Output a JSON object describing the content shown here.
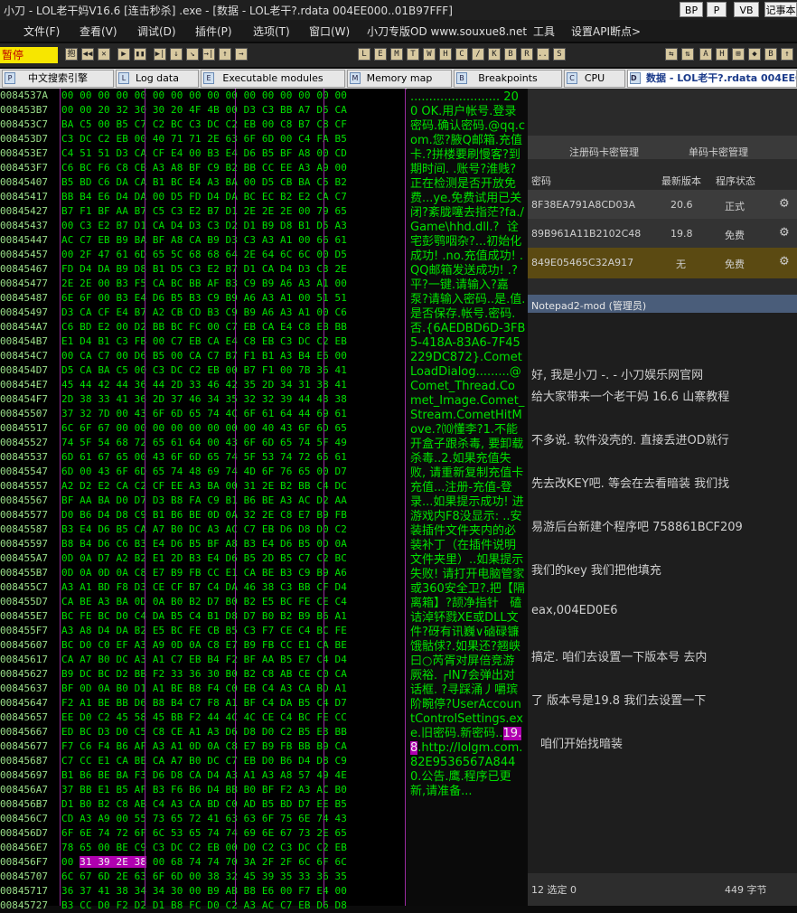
{
  "window": {
    "title": "小刀   - LOL老干妈V16.6 [连击秒杀] .exe - [数据 - LOL老干?.rdata 004EE000..01B97FFF]",
    "buttons": [
      "BP",
      "P",
      "VB",
      "记事本"
    ]
  },
  "menu": [
    "文件(F)",
    "查看(V)",
    "调试(D)",
    "插件(P)",
    "选项(T)",
    "窗口(W)",
    "小刀专版OD www.souxue8.net",
    "工具",
    "设置API断点>"
  ],
  "toolbar": {
    "status": "暂停",
    "left_icons": [
      "抱",
      "◀◀",
      "✕",
      "▶",
      "▮▮",
      "▶|",
      "↓",
      "↘",
      "→|",
      "↑",
      "→"
    ],
    "letter_icons": [
      "L",
      "E",
      "M",
      "T",
      "W",
      "H",
      "C",
      "/",
      "K",
      "B",
      "R",
      "...",
      "S"
    ],
    "right_icons": [
      "⇆",
      "⇅",
      "A",
      "H",
      "⊞",
      "◆",
      "B",
      "↑",
      "▦",
      "✕",
      "A",
      "▣"
    ]
  },
  "tabs": [
    {
      "label": "中文搜索引擎",
      "icon": "P"
    },
    {
      "label": "Log data",
      "icon": "L"
    },
    {
      "label": "Executable modules",
      "icon": "E"
    },
    {
      "label": "Memory map",
      "icon": "M"
    },
    {
      "label": "Breakpoints",
      "icon": "B"
    },
    {
      "label": "CPU",
      "icon": "C"
    },
    {
      "label": "数据 - LOL老干?.rdata 004EE0",
      "icon": "D"
    }
  ],
  "dump": [
    {
      "addr": "0084537A",
      "hex": "00 00 00 00 00 00 00 00 00 00 00 00 00 00 00 00"
    },
    {
      "addr": "008453B7",
      "hex": "00 00 20 32 30 30 20 4F 4B 00 D3 C3 BB A7 D5 CA"
    },
    {
      "addr": "008453C7",
      "hex": "BA C5 00 B5 C7 C2 BC C3 DC C2 EB 00 C8 B7 C8 CF"
    },
    {
      "addr": "008453D7",
      "hex": "C3 DC C2 EB 00 40 71 71 2E 63 6F 6D 00 C4 FA B5"
    },
    {
      "addr": "008453E7",
      "hex": "C4 51 51 D3 CA CF E4 00 B3 E4 D6 B5 BF A8 00 CD"
    },
    {
      "addr": "008453F7",
      "hex": "C6 BC F6 C8 CB A3 A8 BF C9 B2 BB CC EE A3 A9 00"
    },
    {
      "addr": "00845407",
      "hex": "B5 BD C6 DA CA B1 BC E4 A3 BA 00 D5 CB BA C5 B2"
    },
    {
      "addr": "00845417",
      "hex": "BB B4 E6 D4 DA 00 D5 FD D4 DA BC EC B2 E2 CA C7"
    },
    {
      "addr": "00845427",
      "hex": "B7 F1 BF AA B7 C5 C3 E2 B7 D1 2E 2E 2E 00 79 65"
    },
    {
      "addr": "00845437",
      "hex": "00 C3 E2 B7 D1 CA D4 D3 C3 D2 D1 B9 D8 B1 D5 A3"
    },
    {
      "addr": "00845447",
      "hex": "AC C7 EB B9 BA BF A8 CA B9 D3 C3 A3 A1 00 66 61"
    },
    {
      "addr": "00845457",
      "hex": "00 2F 47 61 6D 65 5C 68 68 64 2E 64 6C 6C 00 D5"
    },
    {
      "addr": "00845467",
      "hex": "FD D4 DA B9 D8 B1 D5 C3 E2 B7 D1 CA D4 D3 C3 2E"
    },
    {
      "addr": "00845477",
      "hex": "2E 2E 00 B3 F5 CA BC BB AF B3 C9 B9 A6 A3 A1 00"
    },
    {
      "addr": "00845487",
      "hex": "6E 6F 00 B3 E4 D6 B5 B3 C9 B9 A6 A3 A1 00 51 51"
    },
    {
      "addr": "00845497",
      "hex": "D3 CA CF E4 B7 A2 CB CD B3 C9 B9 A6 A3 A1 00 C6"
    },
    {
      "addr": "008454A7",
      "hex": "C6 BD E2 00 D2 BB BC FC 00 C7 EB CA E4 C8 EB BB"
    },
    {
      "addr": "008454B7",
      "hex": "E1 D4 B1 C3 FB 00 C7 EB CA E4 C8 EB C3 DC C2 EB"
    },
    {
      "addr": "008454C7",
      "hex": "00 CA C7 00 D6 B5 00 CA C7 B7 F1 B1 A3 B4 E6 00"
    },
    {
      "addr": "008454D7",
      "hex": "D5 CA BA C5 00 C3 DC C2 EB 00 B7 F1 00 7B 36 41"
    },
    {
      "addr": "008454E7",
      "hex": "45 44 42 44 36 44 2D 33 46 42 35 2D 34 31 38 41"
    },
    {
      "addr": "008454F7",
      "hex": "2D 38 33 41 36 2D 37 46 34 35 32 32 39 44 43 38"
    },
    {
      "addr": "00845507",
      "hex": "37 32 7D 00 43 6F 6D 65 74 4C 6F 61 64 44 69 61"
    },
    {
      "addr": "00845517",
      "hex": "6C 6F 67 00 00 00 00 00 00 00 00 40 43 6F 6D 65"
    },
    {
      "addr": "00845527",
      "hex": "74 5F 54 68 72 65 61 64 00 43 6F 6D 65 74 5F 49"
    },
    {
      "addr": "00845537",
      "hex": "6D 61 67 65 00 43 6F 6D 65 74 5F 53 74 72 65 61"
    },
    {
      "addr": "00845547",
      "hex": "6D 00 43 6F 6D 65 74 48 69 74 4D 6F 76 65 00 D7"
    },
    {
      "addr": "00845557",
      "hex": "A2 D2 E2 CA C2 CF EE A3 BA 00 31 2E B2 BB C4 DC"
    },
    {
      "addr": "00845567",
      "hex": "BF AA BA D0 D7 D3 B8 FA C9 B1 B6 BE A3 AC D2 AA"
    },
    {
      "addr": "00845577",
      "hex": "D0 B6 D4 D8 C9 B1 B6 BE 0D 0A 32 2E C8 E7 B9 FB"
    },
    {
      "addr": "00845587",
      "hex": "B3 E4 D6 B5 CA A7 B0 DC A3 AC C7 EB D6 D8 D0 C2"
    },
    {
      "addr": "00845597",
      "hex": "B8 B4 D6 C6 B3 E4 D6 B5 BF A8 B3 E4 D6 B5 0D 0A"
    },
    {
      "addr": "008455A7",
      "hex": "0D 0A D7 A2 B2 E1 2D B3 E4 D6 B5 2D B5 C7 C2 BC"
    },
    {
      "addr": "008455B7",
      "hex": "0D 0A 0D 0A C8 E7 B9 FB CC E1 CA BE B3 C9 B9 A6"
    },
    {
      "addr": "008455C7",
      "hex": "A3 A1 BD F8 D3 CE CF B7 C4 DA 46 38 C3 BB CF D4"
    },
    {
      "addr": "008455D7",
      "hex": "CA BE A3 BA 0D 0A B0 B2 D7 B0 B2 E5 BC FE CE C4"
    },
    {
      "addr": "008455E7",
      "hex": "BC FE BC D0 C4 DA B5 C4 B1 D8 D7 B0 B2 B9 B6 A1"
    },
    {
      "addr": "008455F7",
      "hex": "A3 A8 D4 DA B2 E5 BC FE CB B5 C3 F7 CE C4 BC FE"
    },
    {
      "addr": "00845607",
      "hex": "BC D0 C0 EF A3 A9 0D 0A C8 E7 B9 FB CC E1 CA BE"
    },
    {
      "addr": "00845617",
      "hex": "CA A7 B0 DC A3 A1 C7 EB B4 F2 BF AA B5 E7 C4 D4"
    },
    {
      "addr": "00845627",
      "hex": "B9 DC BC D2 BB F2 33 36 30 B0 B2 C8 AB CE C0 CA"
    },
    {
      "addr": "00845637",
      "hex": "BF 0D 0A B0 D1 A1 BE B8 F4 C0 EB C4 A3 CA BD A1"
    },
    {
      "addr": "00845647",
      "hex": "F2 A1 BE BB D6 B8 B4 C7 F8 A1 BF C4 DA B5 C4 D7"
    },
    {
      "addr": "00845657",
      "hex": "EE D0 C2 45 58 45 BB F2 44 4C 4C CE C4 BC FE CC"
    },
    {
      "addr": "00845667",
      "hex": "ED BC D3 D0 C5 C8 CE A1 A3 D6 D8 D0 C2 B5 E3 BB"
    },
    {
      "addr": "00845677",
      "hex": "F7 C6 F4 B6 AF A3 A1 0D 0A C8 E7 B9 FB BB B9 CA"
    },
    {
      "addr": "00845687",
      "hex": "C7 CC E1 CA BE CA A7 B0 DC C7 EB D0 B6 D4 D8 C9"
    },
    {
      "addr": "00845697",
      "hex": "B1 B6 BE BA F3 D6 D8 CA D4 A3 A1 A3 A8 57 49 4E"
    },
    {
      "addr": "008456A7",
      "hex": "37 BB E1 B5 AF B3 F6 B6 D4 BB B0 BF F2 A3 AC B0"
    },
    {
      "addr": "008456B7",
      "hex": "D1 B0 B2 C8 AB C4 A3 CA BD C0 AD B5 BD D7 EE B5"
    },
    {
      "addr": "008456C7",
      "hex": "CD A3 A9 00 55 73 65 72 41 63 63 6F 75 6E 74 43"
    },
    {
      "addr": "008456D7",
      "hex": "6F 6E 74 72 6F 6C 53 65 74 74 69 6E 67 73 2E 65"
    },
    {
      "addr": "008456E7",
      "hex": "78 65 00 BE C9 C3 DC C2 EB 00 D0 C2 C3 DC C2 EB"
    },
    {
      "addr": "008456F7",
      "hex": "00 31 39 2E 38 00 68 74 74 70 3A 2F 2F 6C 6F 6C"
    },
    {
      "addr": "00845707",
      "hex": "6C 67 6D 2E 63 6F 6D 00 38 32 45 39 35 33 36 35"
    },
    {
      "addr": "00845717",
      "hex": "36 37 41 38 34 34 30 00 B9 AB B8 E6 00 F7 E4 00"
    },
    {
      "addr": "00845727",
      "hex": "B3 CC D0 F2 D2 D1 B8 FC D0 C2 A3 AC C7 EB D6 D8"
    }
  ],
  "ascii_text": "........................ 200 OK.用户帐号.登录密码.确认密码.@qq.com.您?腋Q邮箱.充值卡.?拼楼要刷慢客?到期时间. .账号?淮贱?正在检测是否开放免费...ye.免费试用已关闭?紊胧噻去指茫?fa./Game\\hhd.dll.?  诠宅彭鹗咽杂?...初始化成功! .no.充值成功! .QQ邮箱发送成功! .?平?一键.请输入?嘉泵?请输入密码..是.值.是否保存.帐号.密码.否.{6AEDBD6D-3FB5-418A-83A6-7F45229DC872}.CometLoadDialog.........@Comet_Thread.Comet_Image.Comet_Stream.CometHitMove.?⑽懂李?1.不能开盒子跟杀毒, 要卸载杀毒..2.如果充值失败, 请重新复制充值卡充值...注册-充值-登录...如果提示成功! 进游戏内F8没显示: ..安装插件文件夹内的必装补丁（在插件说明文件夹里）..如果提示失败! 请打开电脑管家或360安全卫?.把【隔离箱】?颉净指针   磕诘淖钚戮XE或DLL文件?砑有讯巍∨硵碌镰饿骷俅?.如果还?翘峡曰○芮胥对屏倍竞游厥裕. ┌IN7会弹出对话框. ?寻踩涌丿嚼瑸阶畹停?UserAccountControlSettings.exe.旧密码.新密码..19.8.http://lolgm.com.82E9536567A8440.公告.鹰.程序已更新,请准备...",
  "ascii_highlight": "19.8",
  "background_window": {
    "lines": [
      {
        "text": "注册码卡密管理"
      },
      {
        "text": "单码卡密管理"
      },
      {
        "text": "密码"
      },
      {
        "text": "最新版本"
      },
      {
        "text": "程序状态"
      },
      {
        "text": "8F38EA791A8CD03A"
      },
      {
        "text": "20.6"
      },
      {
        "text": "正式"
      },
      {
        "text": "89B961A11B2102C48"
      },
      {
        "text": "19.8"
      },
      {
        "text": "免费"
      },
      {
        "text": "849E05465C32A917"
      },
      {
        "text": "无"
      },
      {
        "text": "免费"
      },
      {
        "text": "Notepad2-mod (管理员)"
      },
      {
        "text": "好, 我是小刀  -. - 小刀娱乐网官网"
      },
      {
        "text": "给大家带来一个老干妈 16.6 山寨教程"
      },
      {
        "text": "不多说. 软件没壳的. 直接丢进OD就行"
      },
      {
        "text": "先去改KEY吧. 等会在去看暗装 我们找"
      },
      {
        "text": "易游后台新建个程序吧  758861BCF209"
      },
      {
        "text": "我们的key 我们把他填充"
      },
      {
        "text": "eax,004ED0E6"
      },
      {
        "text": "搞定.  咱们去设置一下版本号 去内"
      },
      {
        "text": "了 版本号是19.8 我们去设置一下"
      },
      {
        "text": "咱们开始找暗装"
      },
      {
        "text": "12   选定 0"
      },
      {
        "text": "449 字节"
      }
    ]
  }
}
